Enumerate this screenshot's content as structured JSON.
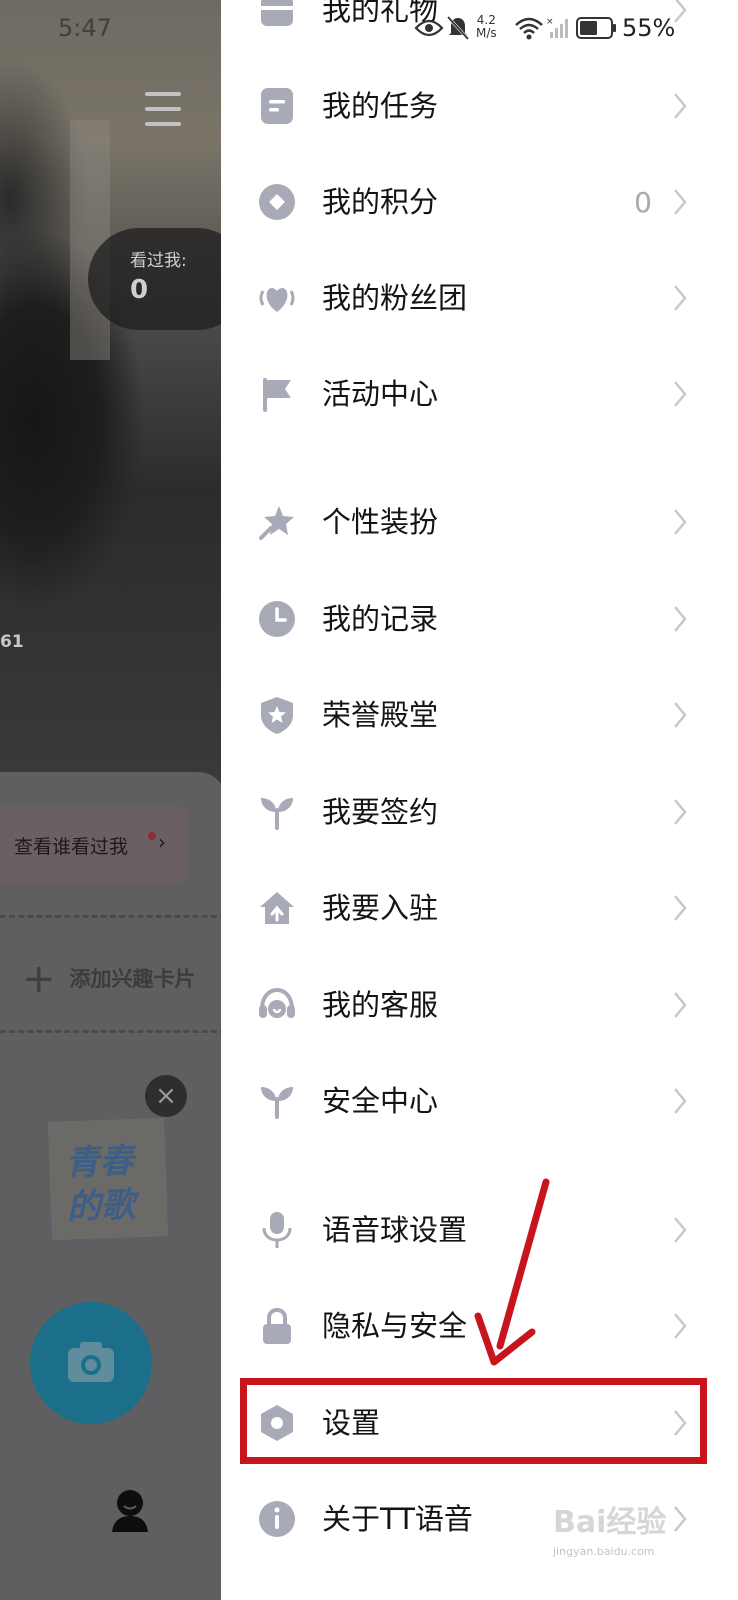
{
  "status_bar": {
    "time": "5:47",
    "net_speed": "4.2",
    "net_unit": "M/s",
    "battery": "55%"
  },
  "background": {
    "seen_label": "看过我:",
    "seen_count": "0",
    "partial_number": "61",
    "viewers_button": "查看谁看过我",
    "add_card": "添加兴趣卡片",
    "sticker_text": "青春的歌"
  },
  "menu": {
    "items": [
      {
        "label": "我的礼物",
        "icon": "gift-icon",
        "value": ""
      },
      {
        "label": "我的任务",
        "icon": "task-icon",
        "value": ""
      },
      {
        "label": "我的积分",
        "icon": "points-icon",
        "value": "0"
      },
      {
        "label": "我的粉丝团",
        "icon": "fan-club-icon",
        "value": ""
      },
      {
        "label": "活动中心",
        "icon": "flag-icon",
        "value": ""
      },
      {
        "label": "个性装扮",
        "icon": "decoration-icon",
        "value": ""
      },
      {
        "label": "我的记录",
        "icon": "clock-icon",
        "value": ""
      },
      {
        "label": "荣誉殿堂",
        "icon": "shield-star-icon",
        "value": ""
      },
      {
        "label": "我要签约",
        "icon": "sprout-icon",
        "value": ""
      },
      {
        "label": "我要入驻",
        "icon": "home-arrow-icon",
        "value": ""
      },
      {
        "label": "我的客服",
        "icon": "headset-icon",
        "value": ""
      },
      {
        "label": "安全中心",
        "icon": "sprout-icon",
        "value": ""
      },
      {
        "label": "语音球设置",
        "icon": "microphone-icon",
        "value": ""
      },
      {
        "label": "隐私与安全",
        "icon": "lock-icon",
        "value": ""
      },
      {
        "label": "设置",
        "icon": "settings-hexagon-icon",
        "value": ""
      },
      {
        "label": "关于TT语音",
        "icon": "info-icon",
        "value": ""
      }
    ]
  },
  "watermark": {
    "brand": "Bai经验",
    "url": "jingyan.baidu.com"
  },
  "colors": {
    "icon_gray": "#a8aab8",
    "chevron_gray": "#c7c7cc",
    "annotation_red": "#c8141b"
  }
}
